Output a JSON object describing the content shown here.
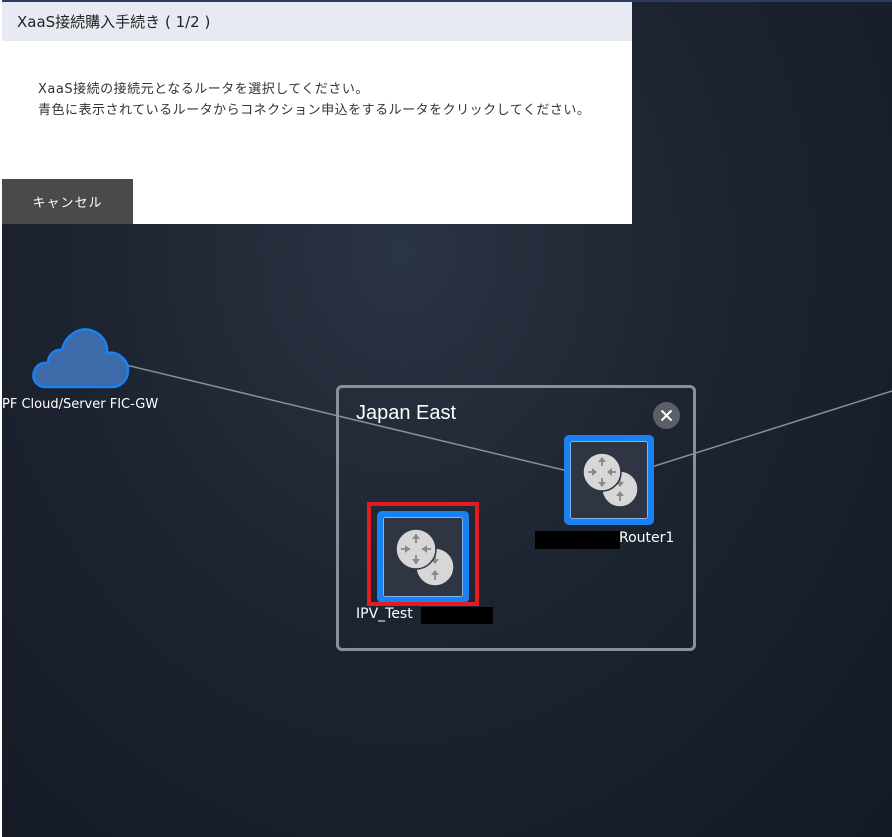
{
  "dialog": {
    "title": "XaaS接続購入手続き ( 1/2 )",
    "line1": "XaaS接続の接続元となるルータを選択してください。",
    "line2": "青色に表示されているルータからコネクション申込をするルータをクリックしてください。",
    "cancel_label": "キャンセル"
  },
  "topology": {
    "cloud_label": "PF Cloud/Server FIC-GW",
    "region_name": "Japan East",
    "routers": [
      {
        "name": "Router1"
      },
      {
        "name": "IPV_Test"
      }
    ]
  },
  "colors": {
    "router_border": "#1a82f0",
    "highlight": "#e31b23",
    "cloud_fill": "#3d6aa8",
    "cloud_stroke": "#1a82f0"
  },
  "icons": {
    "cloud": "cloud-icon",
    "router": "router-icon",
    "close": "close-icon"
  }
}
